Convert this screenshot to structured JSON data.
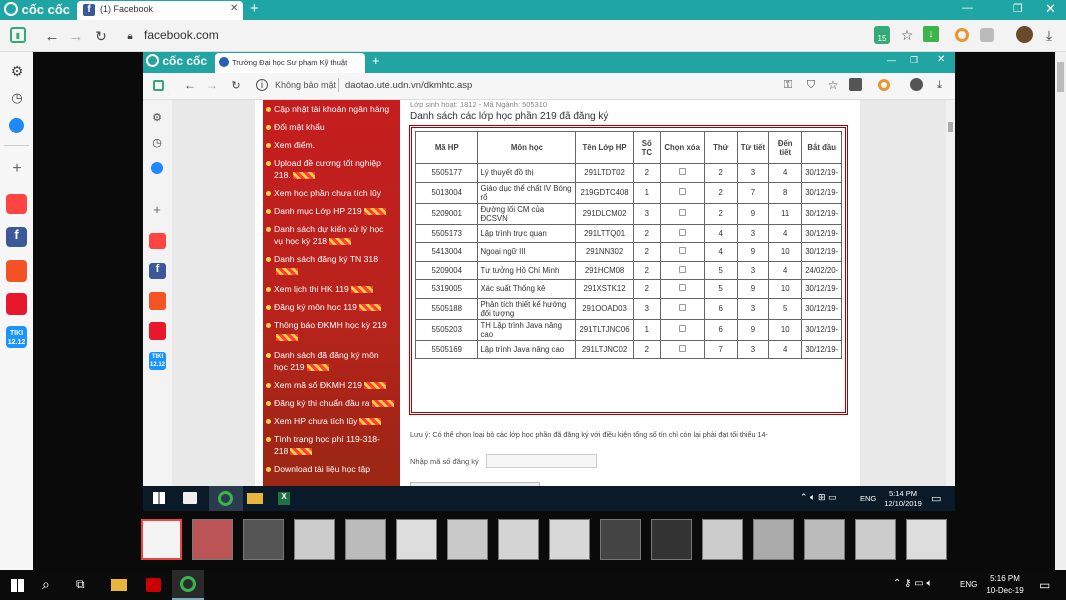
{
  "outer_browser": {
    "brand": "cốc cốc",
    "tab_title": "(1) Facebook",
    "new_tab": "+",
    "url": "facebook.com",
    "badge_count": "15"
  },
  "inner_browser": {
    "brand": "cốc cốc",
    "tab_title": "Trường Đại học Sư phạm Kỹ thuật",
    "security_label": "Không bảo mật",
    "url": "daotao.ute.udn.vn/dkmhtc.asp"
  },
  "menu": {
    "items": [
      {
        "label": "Cập nhật tài khoản ngân hàng",
        "tag": false
      },
      {
        "label": "Đổi mật khẩu",
        "tag": false
      },
      {
        "label": "Xem điểm.",
        "tag": false
      },
      {
        "label": "Upload đề cương tốt nghiệp 218.",
        "tag": true
      },
      {
        "label": "Xem học phần chưa tích lũy",
        "tag": false
      },
      {
        "label": "Danh mục Lớp HP 219",
        "tag": true
      },
      {
        "label": "Danh sách dự kiến xử lý học vụ học kỳ 218",
        "tag": true
      },
      {
        "label": "Danh sách đăng ký TN 318",
        "tag": true
      },
      {
        "label": "Xem lịch thi HK 119",
        "tag": true
      },
      {
        "label": "Đăng ký môn học 119",
        "tag": true
      },
      {
        "label": "Thông báo ĐKMH học kỳ 219",
        "tag": true
      },
      {
        "label": "Danh sách đã đăng ký môn học 219",
        "tag": true
      },
      {
        "label": "Xem mã số ĐKMH 219",
        "tag": true
      },
      {
        "label": "Đăng ký thi chuẩn đầu ra",
        "tag": true
      },
      {
        "label": "Xem HP chưa tích lũy",
        "tag": true
      },
      {
        "label": "Tình trạng học phí 119-318-218",
        "tag": true
      },
      {
        "label": "Download tài liệu học tập",
        "tag": false
      }
    ]
  },
  "page": {
    "class_info": "Lớp sinh hoạt: 1812 - Mã Ngành: 505310",
    "heading": "Danh sách các lớp học phần 219 đã đăng ký",
    "table_headers": [
      "Mã HP",
      "Môn học",
      "Tên Lớp HP",
      "Số TC",
      "Chọn xóa",
      "Thứ",
      "Từ tiết",
      "Đến tiết",
      "Bắt đầu"
    ],
    "rows": [
      [
        "5505177",
        "Lý thuyết đồ thị",
        "291LTDT02",
        "2",
        "",
        "2",
        "3",
        "4",
        "30/12/19-"
      ],
      [
        "5013004",
        "Giáo dục thể chất IV Bóng rổ",
        "219GDTC408",
        "1",
        "",
        "2",
        "7",
        "8",
        "30/12/19-"
      ],
      [
        "5209001",
        "Đường lối CM của ĐCSVN",
        "291DLCM02",
        "3",
        "",
        "2",
        "9",
        "11",
        "30/12/19-"
      ],
      [
        "5505173",
        "Lập trình trực quan",
        "291LTTQ01",
        "2",
        "",
        "4",
        "3",
        "4",
        "30/12/19-"
      ],
      [
        "5413004",
        "Ngoại ngữ III",
        "291NN302",
        "2",
        "",
        "4",
        "9",
        "10",
        "30/12/19-"
      ],
      [
        "5209004",
        "Tư tưởng Hồ Chí Minh",
        "291HCM08",
        "2",
        "",
        "5",
        "3",
        "4",
        "24/02/20-"
      ],
      [
        "5319005",
        "Xác suất Thống kê",
        "291XSTK12",
        "2",
        "",
        "5",
        "9",
        "10",
        "30/12/19-"
      ],
      [
        "5505188",
        "Phân tích thiết kế hướng đối tượng",
        "291OOAD03",
        "3",
        "",
        "6",
        "3",
        "5",
        "30/12/19-"
      ],
      [
        "5505203",
        "TH Lập trình Java nâng cao",
        "291TLTJNC06",
        "1",
        "",
        "6",
        "9",
        "10",
        "30/12/19-"
      ],
      [
        "5505169",
        "Lập trình Java nâng cao",
        "291LTJNC02",
        "2",
        "",
        "7",
        "3",
        "4",
        "30/12/19-"
      ]
    ],
    "note": "Lưu ý: Có thể chọn loại bỏ các lớp học phần đã đăng ký với điều kiện tổng số tín chỉ còn lại phải đạt tối thiểu 14-",
    "register_label": "Nhập mã số đăng ký",
    "register_placeholder": ""
  },
  "inner_taskbar": {
    "lang": "ENG",
    "time": "5:14 PM",
    "date": "12/10/2019"
  },
  "outer_taskbar": {
    "lang": "ENG",
    "time": "5:16 PM",
    "date": "10-Dec-19"
  },
  "sidebar_apps": [
    "settings-icon",
    "history-icon",
    "messenger-icon",
    "add-icon",
    "youtube-icon",
    "facebook-icon",
    "shopee-icon",
    "lazada-icon",
    "tiki-icon"
  ],
  "tiki_label": "TIKI\n12.12"
}
